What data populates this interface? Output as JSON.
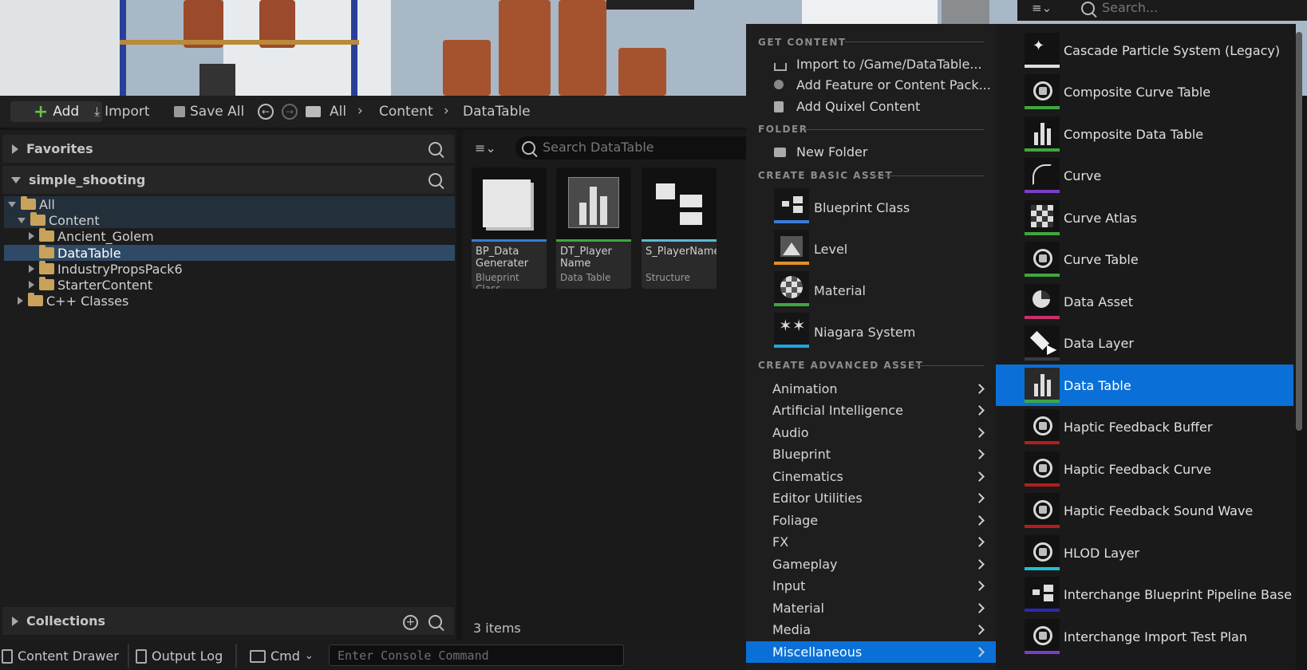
{
  "toolbar": {
    "add_label": "Add",
    "import_label": "Import",
    "save_all_label": "Save All",
    "breadcrumb": [
      "All",
      "Content",
      "DataTable"
    ]
  },
  "left_panel": {
    "favorites_label": "Favorites",
    "project_label": "simple_shooting",
    "collections_label": "Collections",
    "tree": [
      {
        "label": "All"
      },
      {
        "label": "Content"
      },
      {
        "label": "Ancient_Golem"
      },
      {
        "label": "DataTable"
      },
      {
        "label": "IndustryPropsPack6"
      },
      {
        "label": "StarterContent"
      },
      {
        "label": "C++ Classes"
      }
    ]
  },
  "content": {
    "search_placeholder": "Search DataTable",
    "items_count": "3 items",
    "assets": [
      {
        "name": "BP_Data Generater",
        "type": "Blueprint Class",
        "color": "#3a7bd5"
      },
      {
        "name": "DT_Player Name",
        "type": "Data Table",
        "color": "#3fa63f"
      },
      {
        "name": "S_PlayerName",
        "type": "Structure",
        "color": "#5fb6d6"
      }
    ]
  },
  "top_search_placeholder": "Search...",
  "menu": {
    "get_content_header": "GET CONTENT",
    "get_content": [
      "Import to /Game/DataTable...",
      "Add Feature or Content Pack...",
      "Add Quixel Content"
    ],
    "folder_header": "FOLDER",
    "new_folder": "New Folder",
    "basic_header": "CREATE BASIC ASSET",
    "basic": [
      {
        "label": "Blueprint Class",
        "icon": "blueprint-icon",
        "color": "#3a7bd5"
      },
      {
        "label": "Level",
        "icon": "level-icon",
        "color": "#e0902a"
      },
      {
        "label": "Material",
        "icon": "material-icon",
        "color": "#3fa63f"
      },
      {
        "label": "Niagara System",
        "icon": "niagara-icon",
        "color": "#1ea7e0"
      }
    ],
    "advanced_header": "CREATE ADVANCED ASSET",
    "advanced": [
      "Animation",
      "Artificial Intelligence",
      "Audio",
      "Blueprint",
      "Cinematics",
      "Editor Utilities",
      "Foliage",
      "FX",
      "Gameplay",
      "Input",
      "Material",
      "Media",
      "Miscellaneous"
    ],
    "selected_advanced": "Miscellaneous"
  },
  "submenu": [
    {
      "label": "Cascade Particle System (Legacy)",
      "icon": "particle-icon",
      "color": "#dddddd"
    },
    {
      "label": "Composite Curve Table",
      "icon": "sphere-icon",
      "color": "#3fa63f"
    },
    {
      "label": "Composite Data Table",
      "icon": "bar-chart-icon",
      "color": "#3fa63f"
    },
    {
      "label": "Curve",
      "icon": "curve-icon",
      "color": "#7a3fc9"
    },
    {
      "label": "Curve Atlas",
      "icon": "checker-icon",
      "color": "#3fa63f"
    },
    {
      "label": "Curve Table",
      "icon": "sphere-icon",
      "color": "#3fa63f"
    },
    {
      "label": "Data Asset",
      "icon": "pie-icon",
      "color": "#c9306a"
    },
    {
      "label": "Data Layer",
      "icon": "layer-icon",
      "color": "#3a3a3a"
    },
    {
      "label": "Data Table",
      "icon": "bar-chart-icon",
      "color": "#3fa63f"
    },
    {
      "label": "Haptic Feedback Buffer",
      "icon": "sphere-icon",
      "color": "#b51d1d"
    },
    {
      "label": "Haptic Feedback Curve",
      "icon": "sphere-icon",
      "color": "#b51d1d"
    },
    {
      "label": "Haptic Feedback Sound Wave",
      "icon": "sphere-icon",
      "color": "#b51d1d"
    },
    {
      "label": "HLOD Layer",
      "icon": "sphere-icon",
      "color": "#1ec0d6"
    },
    {
      "label": "Interchange Blueprint Pipeline Base",
      "icon": "blueprint-icon",
      "color": "#2a2ab0"
    },
    {
      "label": "Interchange Import Test Plan",
      "icon": "sphere-icon",
      "color": "#7a3fc9"
    }
  ],
  "submenu_selected": "Data Table",
  "statusbar": {
    "content_drawer": "Content Drawer",
    "output_log": "Output Log",
    "cmd": "Cmd",
    "console_placeholder": "Enter Console Command"
  },
  "colors": {
    "selection": "#0a70d8",
    "tree_selection": "#2e4a66",
    "accent_add": "#6cc24a"
  }
}
